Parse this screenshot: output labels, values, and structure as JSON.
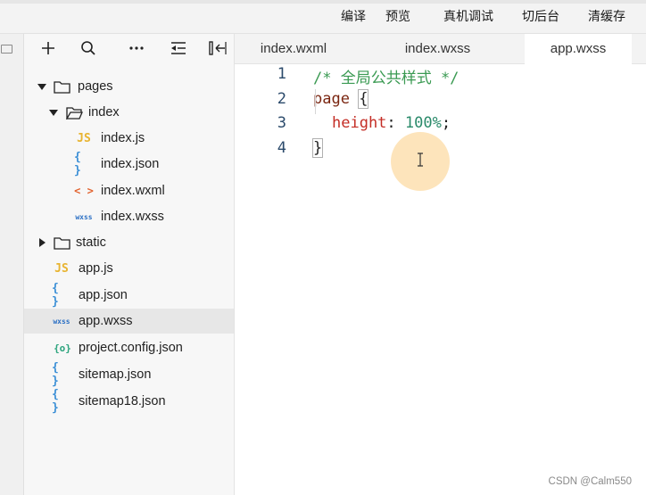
{
  "toolbar": {
    "compile": "编译",
    "preview": "预览",
    "real_device_debug": "真机调试",
    "background": "切后台",
    "clear_cache": "清缓存"
  },
  "explorer": {
    "tools": [
      "new-file-icon",
      "search-icon",
      "more-icon",
      "collapse-icon",
      "layout-icon"
    ],
    "tree": [
      {
        "label": "pages",
        "type": "folder",
        "expanded": true
      },
      {
        "label": "index",
        "type": "folder",
        "expanded": true
      },
      {
        "label": "index.js",
        "type": "js",
        "icon": "JS"
      },
      {
        "label": "index.json",
        "type": "json",
        "icon": "{ }"
      },
      {
        "label": "index.wxml",
        "type": "wxml",
        "icon": "< >"
      },
      {
        "label": "index.wxss",
        "type": "wxss",
        "icon": "wxss"
      },
      {
        "label": "static",
        "type": "folder",
        "expanded": false
      },
      {
        "label": "app.js",
        "type": "js",
        "icon": "JS"
      },
      {
        "label": "app.json",
        "type": "json",
        "icon": "{ }"
      },
      {
        "label": "app.wxss",
        "type": "wxss",
        "icon": "wxss",
        "selected": true
      },
      {
        "label": "project.config.json",
        "type": "config",
        "icon": "{o}"
      },
      {
        "label": "sitemap.json",
        "type": "json",
        "icon": "{ }"
      },
      {
        "label": "sitemap18.json",
        "type": "json",
        "icon": "{ }"
      }
    ]
  },
  "tabs": [
    {
      "label": "index.wxml",
      "active": false
    },
    {
      "label": "index.wxss",
      "active": false
    },
    {
      "label": "app.wxss",
      "active": true
    }
  ],
  "code": {
    "line_numbers": [
      "1",
      "2",
      "3",
      "4"
    ],
    "comment": "/* 全局公共样式 */",
    "selector": "page",
    "open_brace": "{",
    "property": "height",
    "colon": ":",
    "value": "100%",
    "semicolon": ";",
    "close_brace": "}"
  },
  "watermark": "CSDN @Calm550",
  "colors": {
    "comment": "#3a9a52",
    "selector": "#7a2510",
    "property": "#c42d25",
    "number": "#2a8a6a",
    "js_icon": "#e8b431",
    "json_icon": "#3b8fd6",
    "wxml_icon": "#e2632f",
    "wxss_icon": "#2a6fc4",
    "config_icon": "#2aa37c"
  }
}
